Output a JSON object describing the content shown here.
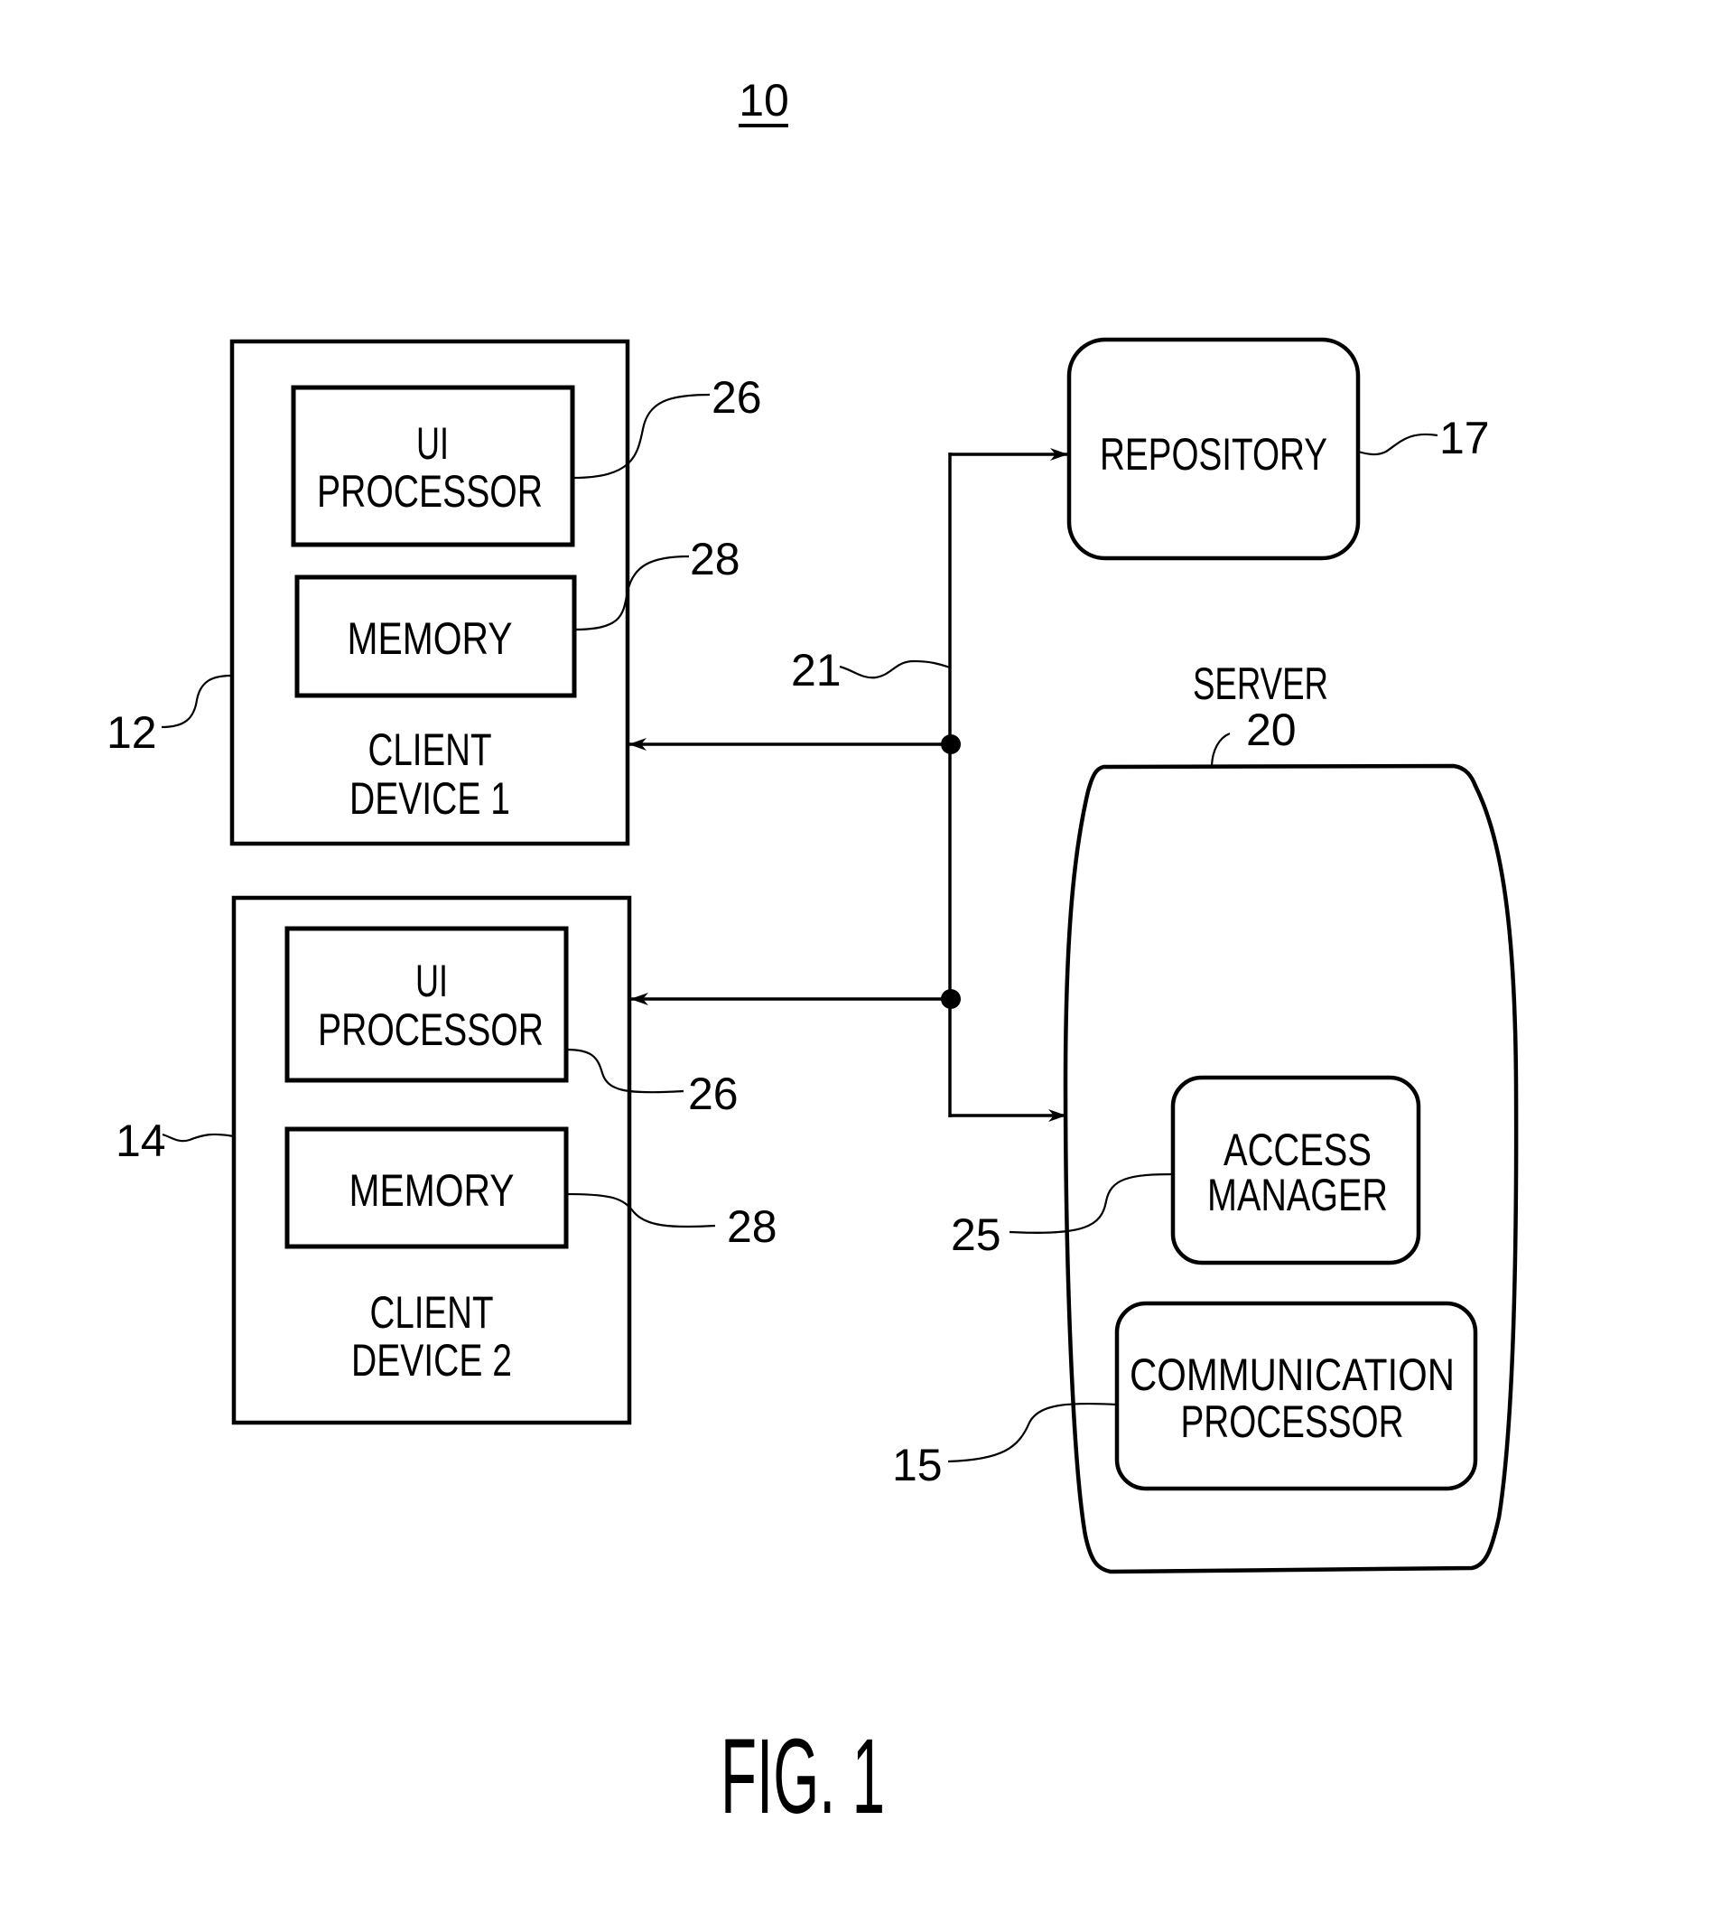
{
  "figure": {
    "ref_number": "10",
    "caption": "FIG. 1"
  },
  "client_device_1": {
    "ref": "12",
    "title_line1": "CLIENT",
    "title_line2": "DEVICE 1",
    "ui_processor": {
      "line1": "UI",
      "line2": "PROCESSOR",
      "ref": "26"
    },
    "memory": {
      "label": "MEMORY",
      "ref": "28"
    }
  },
  "client_device_2": {
    "ref": "14",
    "title_line1": "CLIENT",
    "title_line2": "DEVICE 2",
    "ui_processor": {
      "line1": "UI",
      "line2": "PROCESSOR",
      "ref": "26"
    },
    "memory": {
      "label": "MEMORY",
      "ref": "28"
    }
  },
  "network": {
    "ref": "21"
  },
  "repository": {
    "label": "REPOSITORY",
    "ref": "17"
  },
  "server": {
    "label": "SERVER",
    "ref": "20",
    "access_manager": {
      "line1": "ACCESS",
      "line2": "MANAGER",
      "ref": "25"
    },
    "communication_processor": {
      "line1": "COMMUNICATION",
      "line2": "PROCESSOR",
      "ref": "15"
    }
  }
}
